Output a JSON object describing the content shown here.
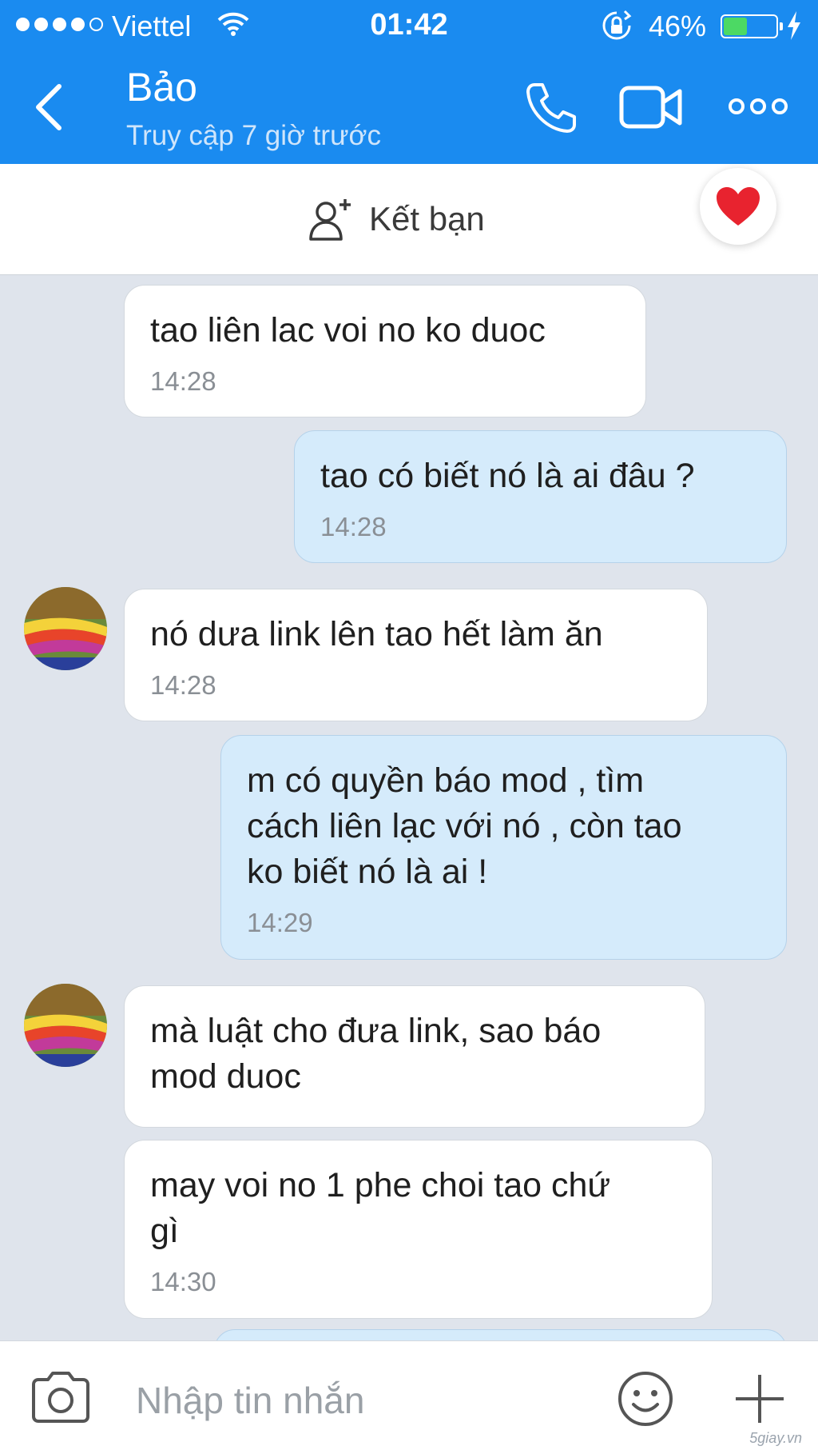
{
  "status_bar": {
    "carrier": "Viettel",
    "time": "01:42",
    "battery": "46%",
    "battery_level": 0.46,
    "signal_bars": 4
  },
  "header": {
    "name": "Bảo",
    "status": "Truy cập 7 giờ trước"
  },
  "friend_bar": {
    "label": "Kết bạn"
  },
  "messages": [
    {
      "side": "in",
      "text": "tao liên lac voi no ko duoc",
      "time": "14:28"
    },
    {
      "side": "out",
      "text": "tao có biết nó là ai đâu ?",
      "time": "14:28"
    },
    {
      "side": "in",
      "text": "nó dưa link lên tao hết làm ăn",
      "time": "14:28"
    },
    {
      "side": "out",
      "text": "m có quyền báo mod , tìm\ncách liên lạc với nó , còn tao\nko biết nó là ai !",
      "time": "14:29"
    },
    {
      "side": "in",
      "text": "mà luật cho đưa link, sao báo\nmod duoc"
    },
    {
      "side": "in",
      "text": "may voi no 1 phe choi tao chứ\ngì",
      "time": "14:30"
    }
  ],
  "composer": {
    "placeholder": "Nhập tin nhắn"
  },
  "watermark": "5giay.vn",
  "colors": {
    "header_bg": "#1a8bf0",
    "outgoing_bubble": "#d5ebfb",
    "incoming_bubble": "#ffffff",
    "chat_bg": "#dfe4ec"
  }
}
